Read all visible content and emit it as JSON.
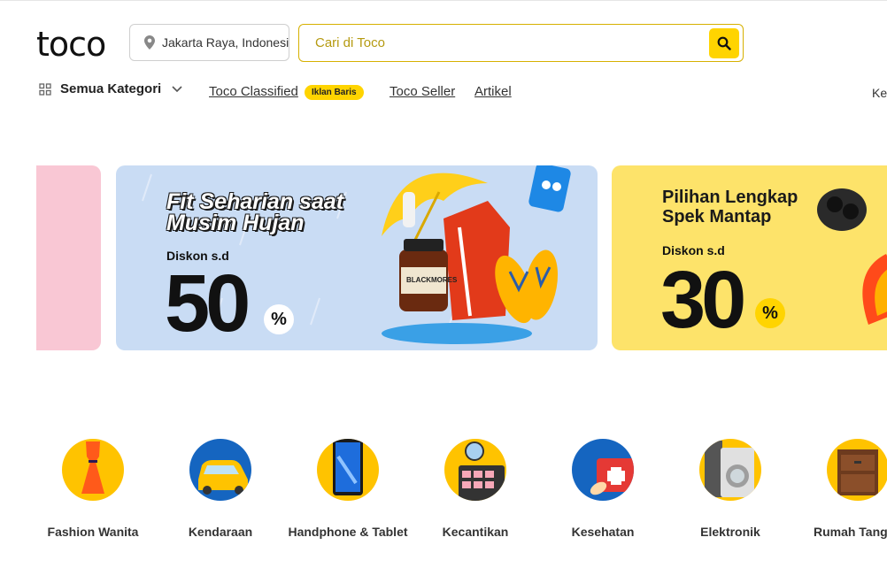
{
  "header": {
    "logo": "toco",
    "location": "Jakarta Raya, Indonesia",
    "search_placeholder": "Cari di Toco"
  },
  "nav": {
    "all_categories": "Semua Kategori",
    "classified": "Toco Classified",
    "classified_badge": "Iklan Baris",
    "seller": "Toco Seller",
    "article": "Artikel",
    "edge_text": "Ke"
  },
  "banners": [
    {
      "title_line1": "Fit Seharian saat",
      "title_line2": "Musim Hujan",
      "discount_label": "Diskon s.d",
      "discount_value": "50",
      "percent": "%"
    },
    {
      "title_line1": "Pilihan Lengkap",
      "title_line2": "Spek Mantap",
      "discount_label": "Diskon s.d",
      "discount_value": "30",
      "percent": "%"
    }
  ],
  "product_text": "BLACKMORES",
  "categories": [
    {
      "label": "Fashion Wanita",
      "icon": "dress-icon"
    },
    {
      "label": "Kendaraan",
      "icon": "car-icon"
    },
    {
      "label": "Handphone & Tablet",
      "icon": "phone-icon"
    },
    {
      "label": "Kecantikan",
      "icon": "makeup-palette-icon"
    },
    {
      "label": "Kesehatan",
      "icon": "first-aid-icon"
    },
    {
      "label": "Elektronik",
      "icon": "washing-machine-icon"
    },
    {
      "label": "Rumah Tangga",
      "icon": "cabinet-icon"
    }
  ],
  "colors": {
    "accent": "#ffd400",
    "banner_blue": "#c9dcf4",
    "banner_yellow": "#fde36a",
    "banner_pink": "#f9c7d4"
  }
}
